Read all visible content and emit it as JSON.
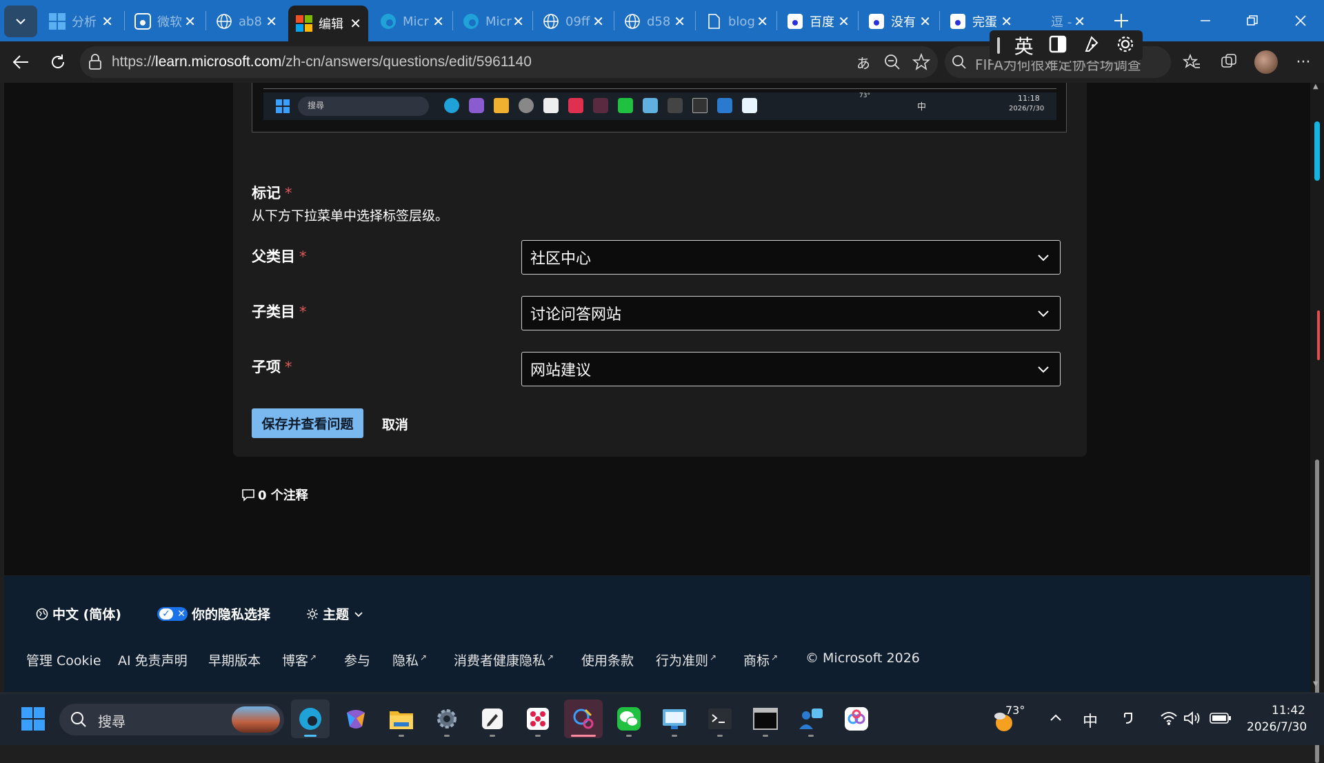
{
  "browser": {
    "tabs": [
      {
        "title": "分析"
      },
      {
        "title": "微软"
      },
      {
        "title": "ab8"
      },
      {
        "title": "编辑"
      },
      {
        "title": "Micr"
      },
      {
        "title": "Micr"
      },
      {
        "title": "09ff"
      },
      {
        "title": "d58"
      },
      {
        "title": "blog"
      },
      {
        "title": "百度"
      },
      {
        "title": "没有"
      },
      {
        "title": "完蛋"
      },
      {
        "title": "逗 -"
      }
    ],
    "url_prefix": "https://",
    "url_host": "learn.microsoft.com",
    "url_path": "/zh-cn/answers/questions/edit/5961140",
    "search_text": "FIFA为何很难定协合场调查",
    "ime": {
      "lang": "英"
    }
  },
  "embedded_taskbar": {
    "search_placeholder": "搜尋",
    "time": "11:18",
    "date": "2026/7/30",
    "temp": "73°",
    "ime": "中"
  },
  "form": {
    "tags_label": "标记",
    "tags_help": "从下方下拉菜单中选择标签层级。",
    "required_mark": "*",
    "parent_label": "父类目",
    "parent_value": "社区中心",
    "child_label": "子类目",
    "child_value": "讨论问答网站",
    "item_label": "子项",
    "item_value": "网站建议",
    "save_label": "保存并查看问题",
    "cancel_label": "取消"
  },
  "comments": {
    "label": "0 个注释"
  },
  "footer": {
    "language": "中文 (简体)",
    "privacy_choice": "你的隐私选择",
    "theme": "主题",
    "links": [
      "管理 Cookie",
      "AI 免责声明",
      "早期版本",
      "博客",
      "参与",
      "隐私",
      "消费者健康隐私",
      "使用条款",
      "行为准则",
      "商标"
    ],
    "copyright": "© Microsoft 2026"
  },
  "taskbar": {
    "search_placeholder": "搜尋",
    "temp": "73°",
    "ime": "中",
    "time": "11:42",
    "date": "2026/7/30"
  },
  "colors": {
    "tab_strip": "#1b6ec2",
    "primary_button": "#7ab8f0",
    "required": "#e05a5a",
    "footer_bg": "#0e1e2e"
  }
}
